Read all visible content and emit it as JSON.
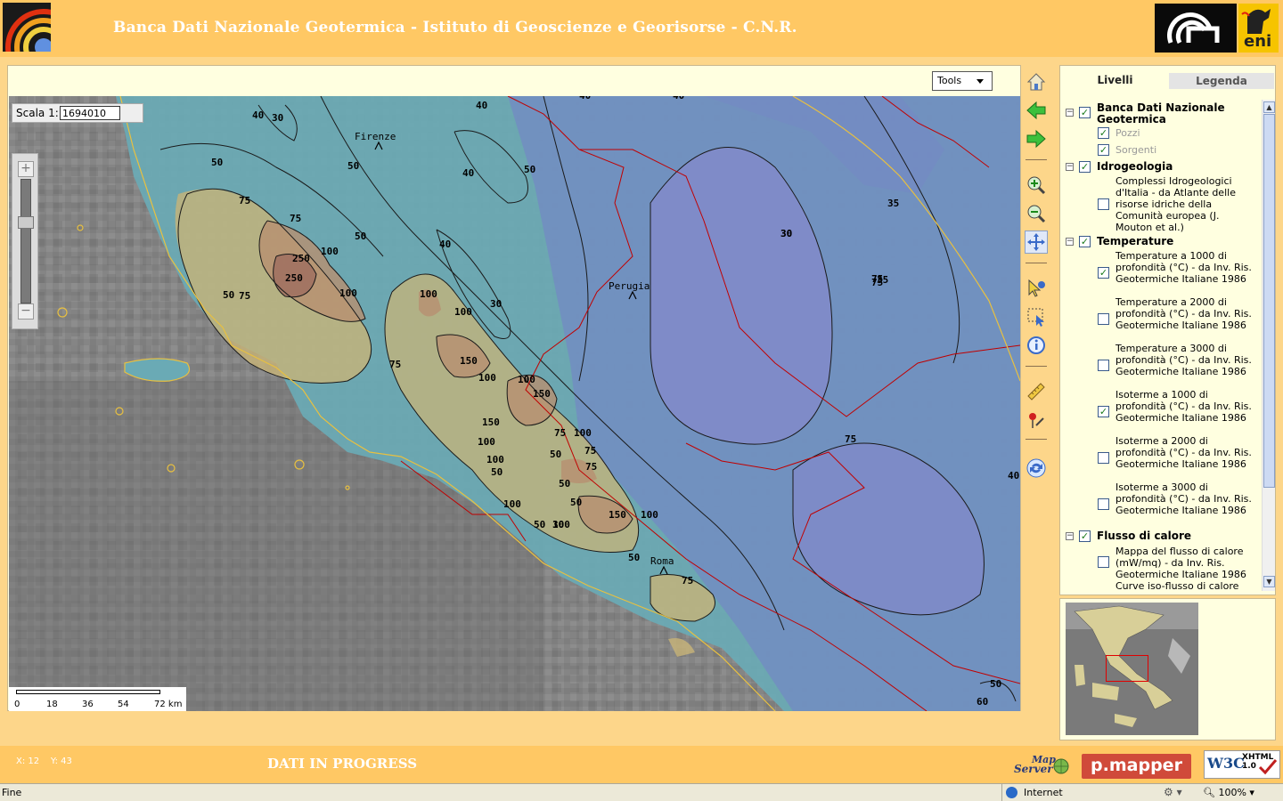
{
  "header": {
    "title": "Banca Dati Nazionale Geotermica -  Istituto di Geoscienze e Georisorse - C.N.R.",
    "eni_logo_text": "eni"
  },
  "map": {
    "tools_label": "Tools",
    "scale_label": "Scala 1:",
    "scale_value": "1694010",
    "scalebar_ticks": [
      "0",
      "18",
      "36",
      "54",
      "72 km"
    ],
    "cities": [
      {
        "name": "Firenze"
      },
      {
        "name": "Perugia"
      },
      {
        "name": "Roma"
      }
    ],
    "contour_labels": [
      "40",
      "30",
      "40",
      "40",
      "40",
      "50",
      "50",
      "50",
      "40",
      "50",
      "75",
      "75",
      "250",
      "250",
      "100",
      "50",
      "75",
      "100",
      "40",
      "100",
      "30",
      "100",
      "75",
      "150",
      "100",
      "100",
      "150",
      "150",
      "75",
      "100",
      "100",
      "75",
      "50",
      "100",
      "75",
      "50",
      "50",
      "100",
      "50",
      "50",
      "100",
      "150",
      "100",
      "75",
      "30",
      "50",
      "75",
      "75",
      "75",
      "30",
      "35",
      "35",
      "30",
      "40",
      "50",
      "60"
    ]
  },
  "toolbar": {
    "tools": [
      "home-icon",
      "back-icon",
      "forward-icon",
      "zoom-in-icon",
      "zoom-out-icon",
      "pan-icon",
      "identify-icon",
      "select-icon",
      "info-icon",
      "measure-icon",
      "poi-icon",
      "refresh-icon"
    ]
  },
  "panel": {
    "tab_livelli": "Livelli",
    "tab_legenda": "Legenda",
    "groups": [
      {
        "label": "Banca Dati Nazionale Geotermica",
        "checked": true,
        "layers": [
          {
            "label": "Pozzi",
            "checked": true
          },
          {
            "label": "Sorgenti",
            "checked": true
          }
        ]
      },
      {
        "label": "Idrogeologia",
        "checked": true,
        "layers": [
          {
            "label": "Complessi Idrogeologici d'Italia - da Atlante delle risorse idriche della Comunità europea (J. Mouton et al.)",
            "checked": false
          }
        ]
      },
      {
        "label": "Temperature",
        "checked": true,
        "layers": [
          {
            "label": "Temperature a 1000 di profondità (°C) - da Inv. Ris. Geotermiche Italiane 1986",
            "checked": true
          },
          {
            "label": "Temperature a 2000 di profondità (°C) - da Inv. Ris. Geotermiche Italiane 1986",
            "checked": false
          },
          {
            "label": "Temperature a 3000 di profondità (°C) - da Inv. Ris. Geotermiche Italiane 1986",
            "checked": false
          },
          {
            "label": "Isoterme a 1000 di profondità (°C) - da Inv. Ris. Geotermiche Italiane 1986",
            "checked": true
          },
          {
            "label": "Isoterme a 2000 di profondità (°C) - da Inv. Ris. Geotermiche Italiane 1986",
            "checked": false
          },
          {
            "label": "Isoterme a 3000 di profondità (°C) - da Inv. Ris. Geotermiche Italiane 1986",
            "checked": false
          }
        ]
      },
      {
        "label": "Flusso di calore",
        "checked": true,
        "layers": [
          {
            "label": "Mappa del flusso di calore (mW/mq) - da Inv. Ris. Geotermiche Italiane 1986",
            "checked": false
          },
          {
            "label": "Curve iso-flusso di calore",
            "checked": false
          }
        ]
      }
    ]
  },
  "footer": {
    "coord_x": "X: 12",
    "coord_y": "Y: 43",
    "in_progress": "DATI IN PROGRESS",
    "mapserver_line1": "Map",
    "mapserver_line2": "Server",
    "pmapper": "p.mapper",
    "w3c": "W3C",
    "xhtml_line1": "XHTML",
    "xhtml_line2": "1.0"
  },
  "statusbar": {
    "status": "Fine",
    "zone": "Internet",
    "zoom": "100%"
  },
  "colors": {
    "header_bg": "#ffc864",
    "panel_bg": "#ffffe0",
    "contour_hot": "#b08a6a",
    "contour_warm": "#b8b070",
    "contour_mid": "#6aaab5",
    "contour_cool": "#6a7ac0",
    "border_red": "#c00000"
  }
}
